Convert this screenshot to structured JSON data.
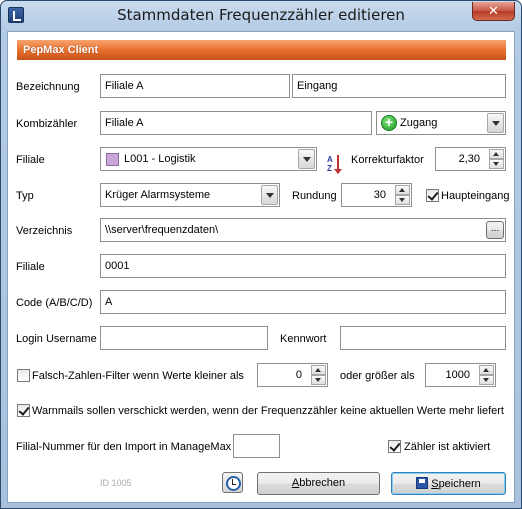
{
  "window": {
    "title": "Stammdaten Frequenzzähler editieren",
    "close_label": "✕"
  },
  "banner": {
    "text": "PepMax Client"
  },
  "fields": {
    "bezeichnung": {
      "label": "Bezeichnung",
      "value1": "Filiale A",
      "value2": "Eingang"
    },
    "kombizaehler": {
      "label": "Kombizähler",
      "value": "Filiale A",
      "zugang": "Zugang"
    },
    "filiale_select": {
      "label": "Filiale",
      "value": "L001 - Logistik"
    },
    "korrekturfaktor": {
      "label": "Korrekturfaktor",
      "value": "2,30"
    },
    "typ": {
      "label": "Typ",
      "value": "Krüger Alarmsysteme"
    },
    "rundung": {
      "label": "Rundung",
      "value": "30"
    },
    "haupteingang": {
      "label": "Haupteingang",
      "checked": true
    },
    "verzeichnis": {
      "label": "Verzeichnis",
      "value": "\\\\server\\frequenzdaten\\",
      "browse_label": "..."
    },
    "filiale_nr": {
      "label": "Filiale",
      "value": "0001"
    },
    "code": {
      "label": "Code (A/B/C/D)",
      "value": "A"
    },
    "login": {
      "label": "Login Username",
      "value": ""
    },
    "kennwort": {
      "label": "Kennwort",
      "value": ""
    },
    "falsch_filter": {
      "label": "Falsch-Zahlen-Filter wenn Werte kleiner als",
      "checked": false,
      "min_value": "0",
      "groesser_label": "oder größer als",
      "max_value": "1000"
    },
    "warnmails": {
      "label": "Warnmails sollen verschickt werden, wenn der Frequenzzähler keine aktuellen Werte mehr liefert",
      "checked": true
    },
    "import_nr": {
      "label": "Filial-Nummer für den Import in ManageMax",
      "value": ""
    },
    "aktiviert": {
      "label": "Zähler ist aktiviert",
      "checked": true
    }
  },
  "footer": {
    "id_label": "ID 1005",
    "cancel_label_pre": "",
    "cancel_label_u": "A",
    "cancel_label_post": "bbrechen",
    "save_label_u": "S",
    "save_label_post": "peichern"
  },
  "colors": {
    "banner": "#e8702f",
    "filiale_color": "#c8a6dc",
    "accent": "#2b56a6"
  }
}
